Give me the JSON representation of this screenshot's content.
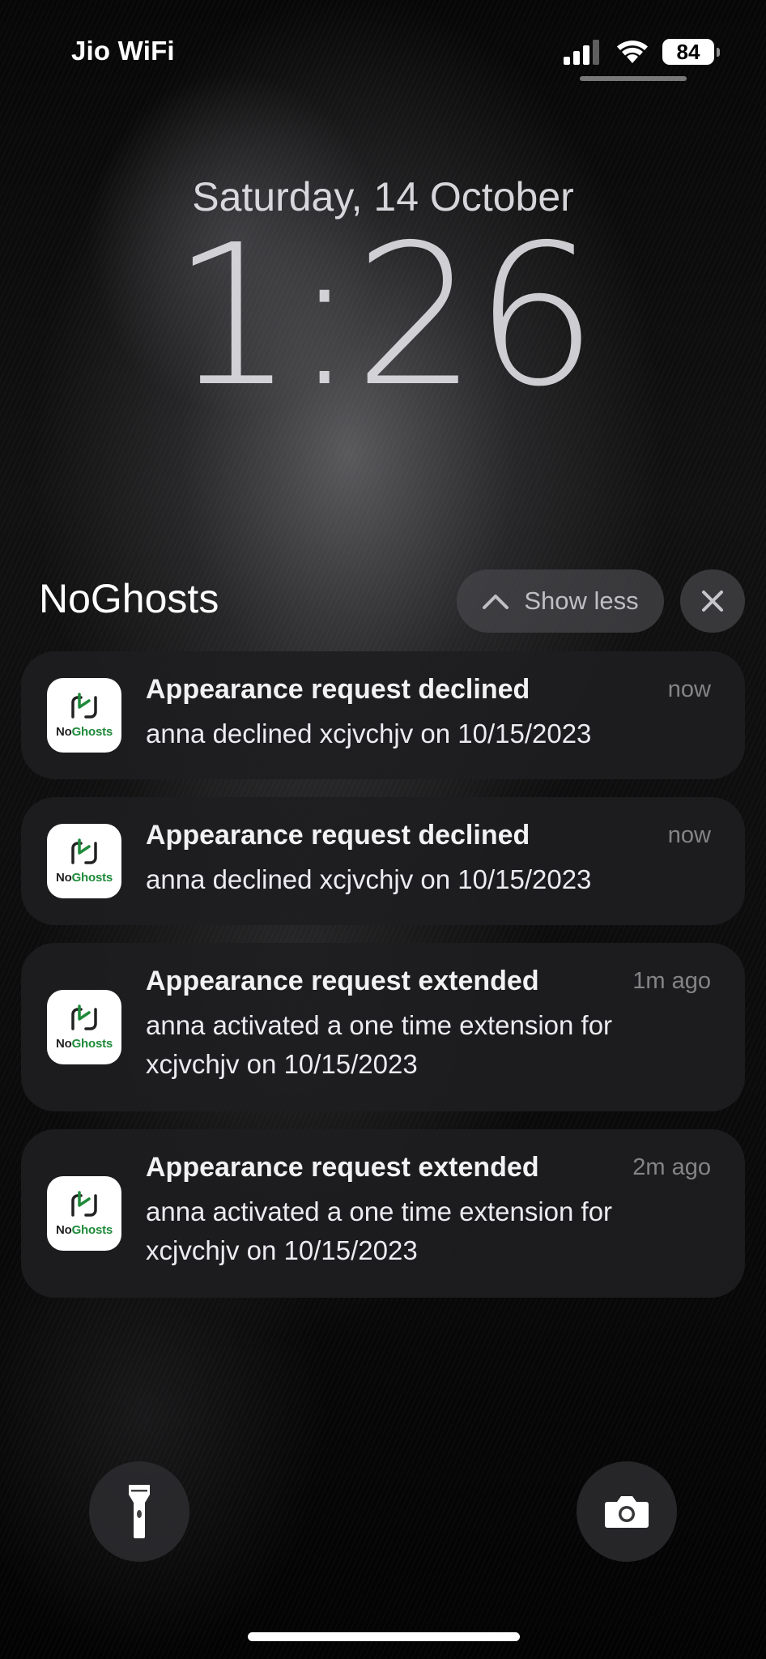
{
  "status_bar": {
    "carrier": "Jio WiFi",
    "battery": "84",
    "icons": [
      "signal-bars-icon",
      "wifi-icon",
      "battery-icon"
    ]
  },
  "lock_screen": {
    "date": "Saturday, 14 October",
    "time": "1:26"
  },
  "notification_group": {
    "app_name": "NoGhosts",
    "show_less_label": "Show less",
    "app_icon": {
      "label_prefix": "No",
      "label_suffix": "Ghosts",
      "brand_color": "#1f8a3a"
    },
    "notifications": [
      {
        "title": "Appearance request declined",
        "time": "now",
        "body": "anna declined xcjvchjv on 10/15/2023"
      },
      {
        "title": "Appearance request declined",
        "time": "now",
        "body": "anna declined xcjvchjv on 10/15/2023"
      },
      {
        "title": "Appearance request extended",
        "time": "1m ago",
        "body": "anna activated a one time extension for xcjvchjv on 10/15/2023"
      },
      {
        "title": "Appearance request extended",
        "time": "2m ago",
        "body": "anna activated a one time extension for xcjvchjv on 10/15/2023"
      }
    ]
  },
  "bottom_controls": {
    "left": "flashlight-icon",
    "right": "camera-icon"
  }
}
